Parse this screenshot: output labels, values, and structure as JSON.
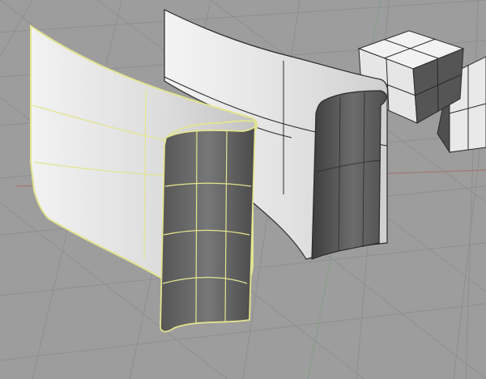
{
  "viewport": {
    "type": "perspective-3d-modeling-view",
    "colors": {
      "background": "#9d9d9d",
      "grid_line": "#8e8e8e",
      "x_axis": "#a07474",
      "y_axis": "#7a9a7a",
      "selection_highlight": "#e6e88a",
      "surface_edge": "#2a2a2a",
      "shaded_light": "#ededed",
      "shaded_dark": "#4a4a4a"
    },
    "objects": [
      {
        "name": "selected-curved-surface-left",
        "selected": true
      },
      {
        "name": "curved-surface-back",
        "selected": false
      },
      {
        "name": "box-back",
        "selected": false
      },
      {
        "name": "box-right",
        "selected": false
      }
    ]
  }
}
